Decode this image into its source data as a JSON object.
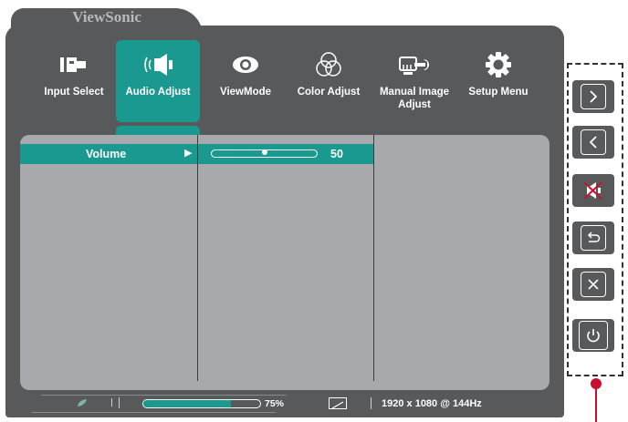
{
  "brand": "ViewSonic",
  "menu": [
    {
      "label": "Input Select",
      "icon": "input-select-icon",
      "active": false
    },
    {
      "label": "Audio Adjust",
      "icon": "speaker-icon",
      "active": true
    },
    {
      "label": "ViewMode",
      "icon": "eye-icon",
      "active": false
    },
    {
      "label": "Color Adjust",
      "icon": "color-circles-icon",
      "active": false
    },
    {
      "label": "Manual Image Adjust",
      "icon": "monitor-wrench-icon",
      "active": false
    },
    {
      "label": "Setup Menu",
      "icon": "gear-icon",
      "active": false
    }
  ],
  "submenu": {
    "volume_label": "Volume",
    "arrow": "▶",
    "volume_value": "50",
    "volume_level": 50
  },
  "status": {
    "progress_label": "75%",
    "progress_level": 75,
    "resolution": "1920 x 1080 @ 144Hz"
  },
  "keys": [
    {
      "name": "next-key",
      "icon": "chevron-right-icon"
    },
    {
      "name": "previous-key",
      "icon": "chevron-left-icon"
    },
    {
      "name": "mute-key",
      "icon": "mute-icon"
    },
    {
      "name": "back-key",
      "icon": "return-icon"
    },
    {
      "name": "close-key",
      "icon": "close-icon"
    },
    {
      "name": "power-key",
      "icon": "power-icon"
    }
  ],
  "colors": {
    "osd_bg": "#58595b",
    "accent": "#1a9990",
    "panel_bg": "#a7a9ac",
    "pointer": "#c8102e"
  }
}
